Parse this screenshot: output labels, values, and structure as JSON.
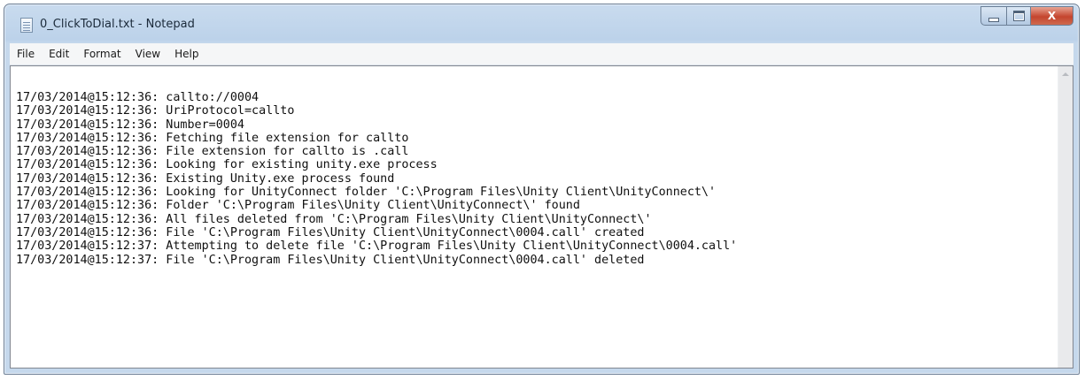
{
  "window": {
    "title": "0_ClickToDial.txt - Notepad",
    "icon": "notepad-icon"
  },
  "caption_buttons": {
    "minimize_icon": "minimize-icon",
    "maximize_icon": "maximize-icon",
    "close_label": "X"
  },
  "menu": {
    "items": [
      "File",
      "Edit",
      "Format",
      "View",
      "Help"
    ]
  },
  "editor": {
    "lines": [
      "17/03/2014@15:12:36: callto://0004",
      "17/03/2014@15:12:36: UriProtocol=callto",
      "17/03/2014@15:12:36: Number=0004",
      "17/03/2014@15:12:36: Fetching file extension for callto",
      "17/03/2014@15:12:36: File extension for callto is .call",
      "17/03/2014@15:12:36: Looking for existing unity.exe process",
      "17/03/2014@15:12:36: Existing Unity.exe process found",
      "17/03/2014@15:12:36: Looking for UnityConnect folder 'C:\\Program Files\\Unity Client\\UnityConnect\\'",
      "17/03/2014@15:12:36: Folder 'C:\\Program Files\\Unity Client\\UnityConnect\\' found",
      "17/03/2014@15:12:36: All files deleted from 'C:\\Program Files\\Unity Client\\UnityConnect\\'",
      "17/03/2014@15:12:36: File 'C:\\Program Files\\Unity Client\\UnityConnect\\0004.call' created",
      "17/03/2014@15:12:37: Attempting to delete file 'C:\\Program Files\\Unity Client\\UnityConnect\\0004.call'",
      "17/03/2014@15:12:37: File 'C:\\Program Files\\Unity Client\\UnityConnect\\0004.call' deleted"
    ]
  }
}
